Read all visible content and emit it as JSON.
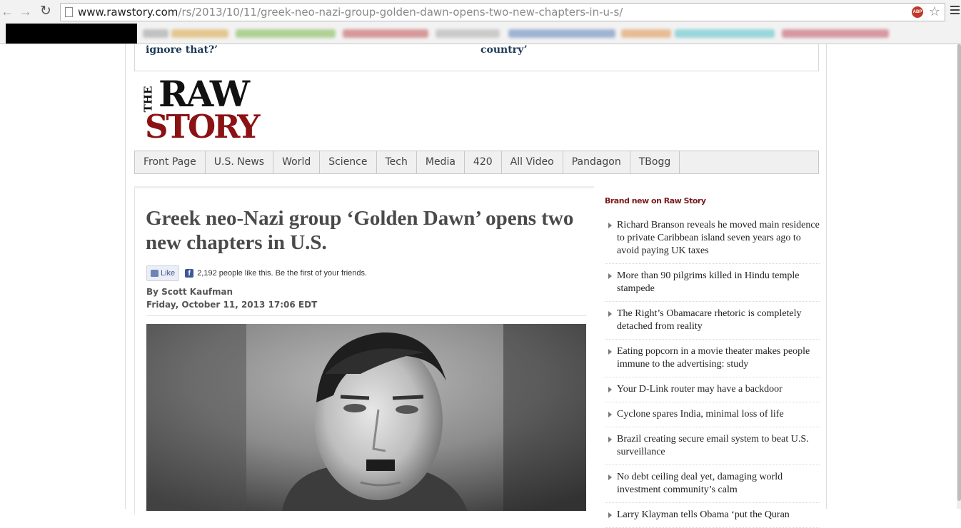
{
  "browser": {
    "url_host": "www.rawstory.com",
    "url_path": "/rs/2013/10/11/greek-neo-nazi-group-golden-dawn-opens-two-new-chapters-in-u-s/",
    "abp_label": "ABP"
  },
  "top_strip": {
    "left_link": "ignore that?’",
    "right_link": "country’"
  },
  "logo": {
    "the": "THE",
    "raw": "RAW",
    "story": "STORY"
  },
  "nav": {
    "items": [
      "Front Page",
      "U.S. News",
      "World",
      "Science",
      "Tech",
      "Media",
      "420",
      "All Video",
      "Pandagon",
      "TBogg"
    ]
  },
  "article": {
    "headline": "Greek neo-Nazi group ‘Golden Dawn’ opens two new chapters in U.S.",
    "like_label": "Like",
    "like_count_text": "2,192 people like this. Be the first of your friends.",
    "byline": "By Scott Kaufman",
    "date": "Friday, October 11, 2013 17:06 EDT"
  },
  "sidebar": {
    "heading": "Brand new on Raw Story",
    "items": [
      "Richard Branson reveals he moved main residence to private Caribbean island seven years ago to avoid paying UK taxes",
      "More than 90 pilgrims killed in Hindu temple stampede",
      "The Right’s Obamacare rhetoric is completely detached from reality",
      "Eating popcorn in a movie theater makes people immune to the advertising: study",
      "Your D-Link router may have a backdoor",
      "Cyclone spares India, minimal loss of life",
      "Brazil creating secure email system to beat U.S. surveillance",
      "No debt ceiling deal yet, damaging world investment community’s calm",
      "Larry Klayman tells Obama ‘put the Quran"
    ]
  }
}
